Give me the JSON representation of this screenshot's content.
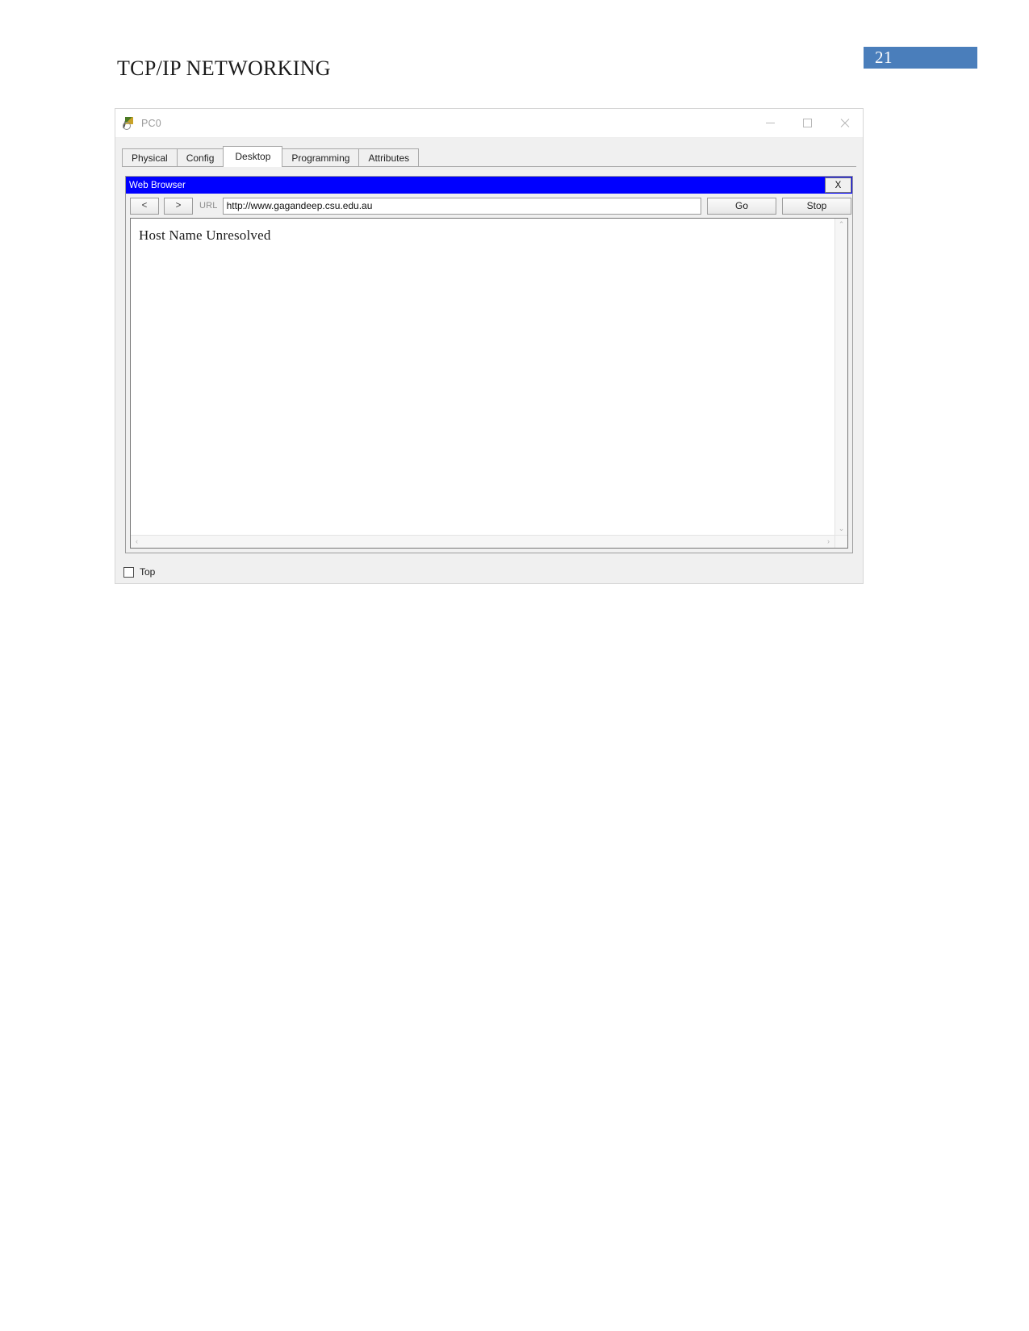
{
  "document": {
    "heading": "TCP/IP NETWORKING",
    "page_number": "21",
    "page_badge_color": "#4a7ebb"
  },
  "pt_window": {
    "title": "PC0",
    "icon": "packet-tracer-device-icon",
    "controls": {
      "minimize": "–",
      "maximize": "□",
      "close": "×"
    },
    "tabs": [
      {
        "label": "Physical",
        "active": false
      },
      {
        "label": "Config",
        "active": false
      },
      {
        "label": "Desktop",
        "active": true
      },
      {
        "label": "Programming",
        "active": false
      },
      {
        "label": "Attributes",
        "active": false
      }
    ],
    "footer": {
      "top_checkbox_label": "Top",
      "top_checkbox_checked": false
    }
  },
  "web_browser": {
    "title": "Web Browser",
    "title_bg_color": "#0000ff",
    "title_text_color": "#ffffff",
    "close_button_label": "X",
    "toolbar": {
      "back_label": "<",
      "forward_label": ">",
      "url_label": "URL",
      "url_value": "http://www.gagandeep.csu.edu.au",
      "url_placeholder": "",
      "go_label": "Go",
      "stop_label": "Stop"
    },
    "content": {
      "message": "Host Name Unresolved"
    },
    "scrollbars": {
      "vertical_up": "⌃",
      "vertical_down": "⌄",
      "horizontal_left": "‹",
      "horizontal_right": "›"
    }
  }
}
